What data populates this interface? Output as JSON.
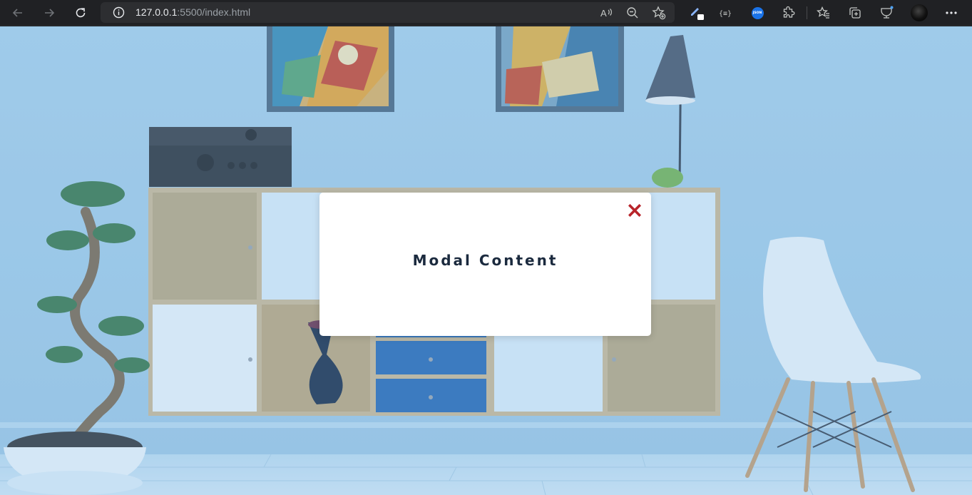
{
  "browser": {
    "url_host": "127.0.0.1",
    "url_rest": ":5500/index.html",
    "icons": {
      "back": "arrow-left-icon",
      "forward": "arrow-right-icon",
      "reload": "reload-icon",
      "site_info": "info-icon",
      "read_aloud": "read-aloud-icon",
      "zoom": "zoom-out-icon",
      "add_favorite": "add-favorite-icon",
      "extensions": [
        "pen-extension-icon",
        "bracket-extension-icon",
        "json-extension-icon",
        "puzzle-icon"
      ],
      "favorites": "favorites-icon",
      "collections": "collections-icon",
      "browser_essentials": "heart-pulse-icon",
      "profile": "avatar",
      "menu": "more-icon"
    },
    "json_ext_label": "JSON"
  },
  "modal": {
    "content": "Modal Content",
    "close_icon": "close-icon",
    "close_color": "#b8242a"
  },
  "colors": {
    "chrome_bg": "#202124",
    "address_bg": "#2d2e31",
    "modal_text": "#1b2a3e",
    "wall": "#a6cfe9"
  }
}
